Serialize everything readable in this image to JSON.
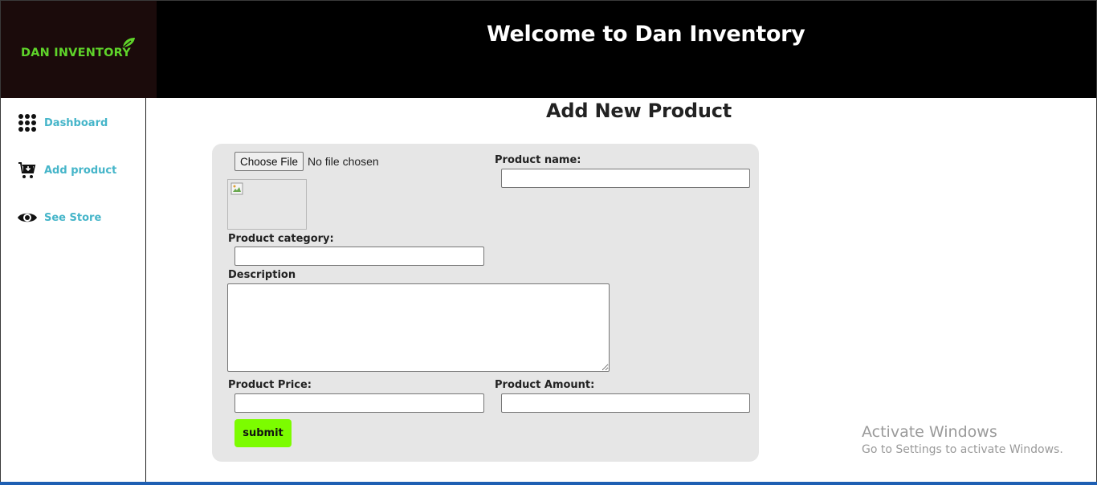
{
  "brand": {
    "logo_text": "DAN INVENTORY",
    "logo_icon": "leaf-icon",
    "accent_color": "#5fd42a"
  },
  "header": {
    "title": "Welcome to Dan Inventory"
  },
  "sidebar": {
    "items": [
      {
        "label": "Dashboard",
        "icon": "grid-icon"
      },
      {
        "label": "Add product",
        "icon": "cart-add-icon"
      },
      {
        "label": "See Store",
        "icon": "eye-icon"
      }
    ],
    "link_color": "#45b5c9"
  },
  "main": {
    "title": "Add New Product",
    "form": {
      "file_button_label": "Choose File",
      "file_status": "No file chosen",
      "product_name_label": "Product name:",
      "product_name_value": "",
      "product_category_label": "Product category:",
      "product_category_value": "",
      "description_label": "Description",
      "description_value": "",
      "product_price_label": "Product Price:",
      "product_price_value": "",
      "product_amount_label": "Product Amount:",
      "product_amount_value": "",
      "submit_label": "submit",
      "submit_color": "#7cfc00"
    }
  },
  "watermark": {
    "title": "Activate Windows",
    "subtitle": "Go to Settings to activate Windows."
  }
}
